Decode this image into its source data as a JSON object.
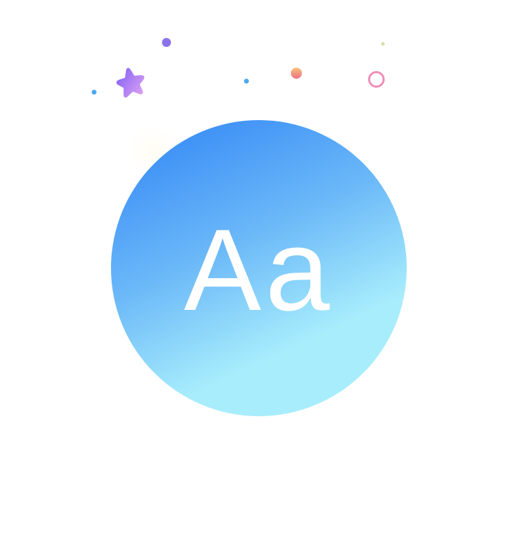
{
  "illustration": {
    "font_sample_text": "Aa",
    "icon_name": "font-icon",
    "colors": {
      "circle_gradient_start": "#3A8DF6",
      "circle_gradient_mid": "#6CB9F8",
      "circle_gradient_end": "#A8EDFC",
      "text": "#FFFFFF",
      "star_gradient_start": "#7B5CF5",
      "star_gradient_end": "#E4A6F2",
      "dot_purple": "#8C72EA",
      "dot_blue": "#4AA8F2",
      "dot_orange_start": "#F6C27A",
      "dot_orange_end": "#EE6F84",
      "dot_olive": "#D6DDA6",
      "ring_pink": "#EE8DB6",
      "glow": "#FFF8DC"
    }
  }
}
